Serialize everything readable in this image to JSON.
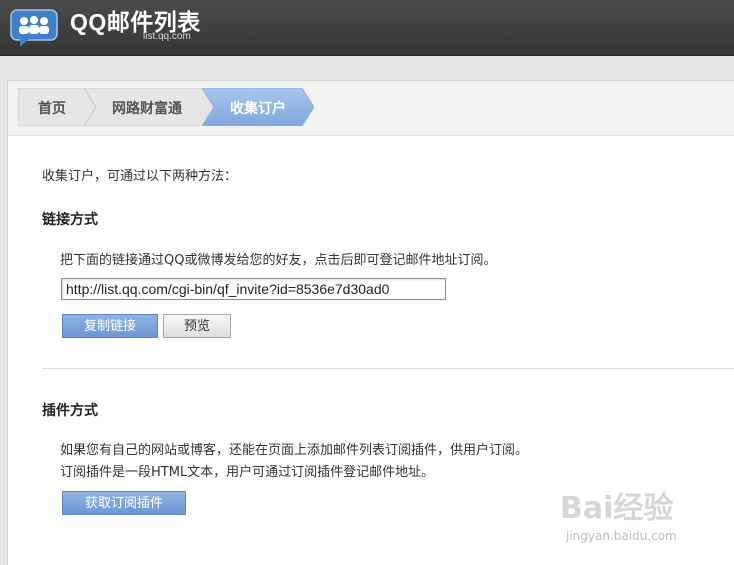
{
  "header": {
    "title": "QQ邮件列表",
    "subtitle": "list.qq.com",
    "logo_icon": "people-chat-icon"
  },
  "breadcrumb": {
    "items": [
      {
        "label": "首页"
      },
      {
        "label": "网路财富通"
      },
      {
        "label": "收集订户"
      }
    ]
  },
  "main": {
    "intro": "收集订户，可通过以下两种方法：",
    "link_section": {
      "title": "链接方式",
      "description": "把下面的链接通过QQ或微博发给您的好友，点击后即可登记邮件地址订阅。",
      "url_value": "http://list.qq.com/cgi-bin/qf_invite?id=8536e7d30ad0",
      "copy_button": "复制链接",
      "preview_button": "预览"
    },
    "plugin_section": {
      "title": "插件方式",
      "line1": "如果您有自己的网站或博客，还能在页面上添加邮件列表订阅插件，供用户订阅。",
      "line2": "订阅插件是一段HTML文本，用户可通过订阅插件登记邮件地址。",
      "get_button": "获取订阅插件"
    }
  },
  "watermark": {
    "main": "Bai经验",
    "sub": "jingyan.baidu.com"
  },
  "colors": {
    "topbar": "#3d3d3d",
    "accent_blue": "#7aa2d8",
    "crumb_grey": "#e9e9e9"
  }
}
